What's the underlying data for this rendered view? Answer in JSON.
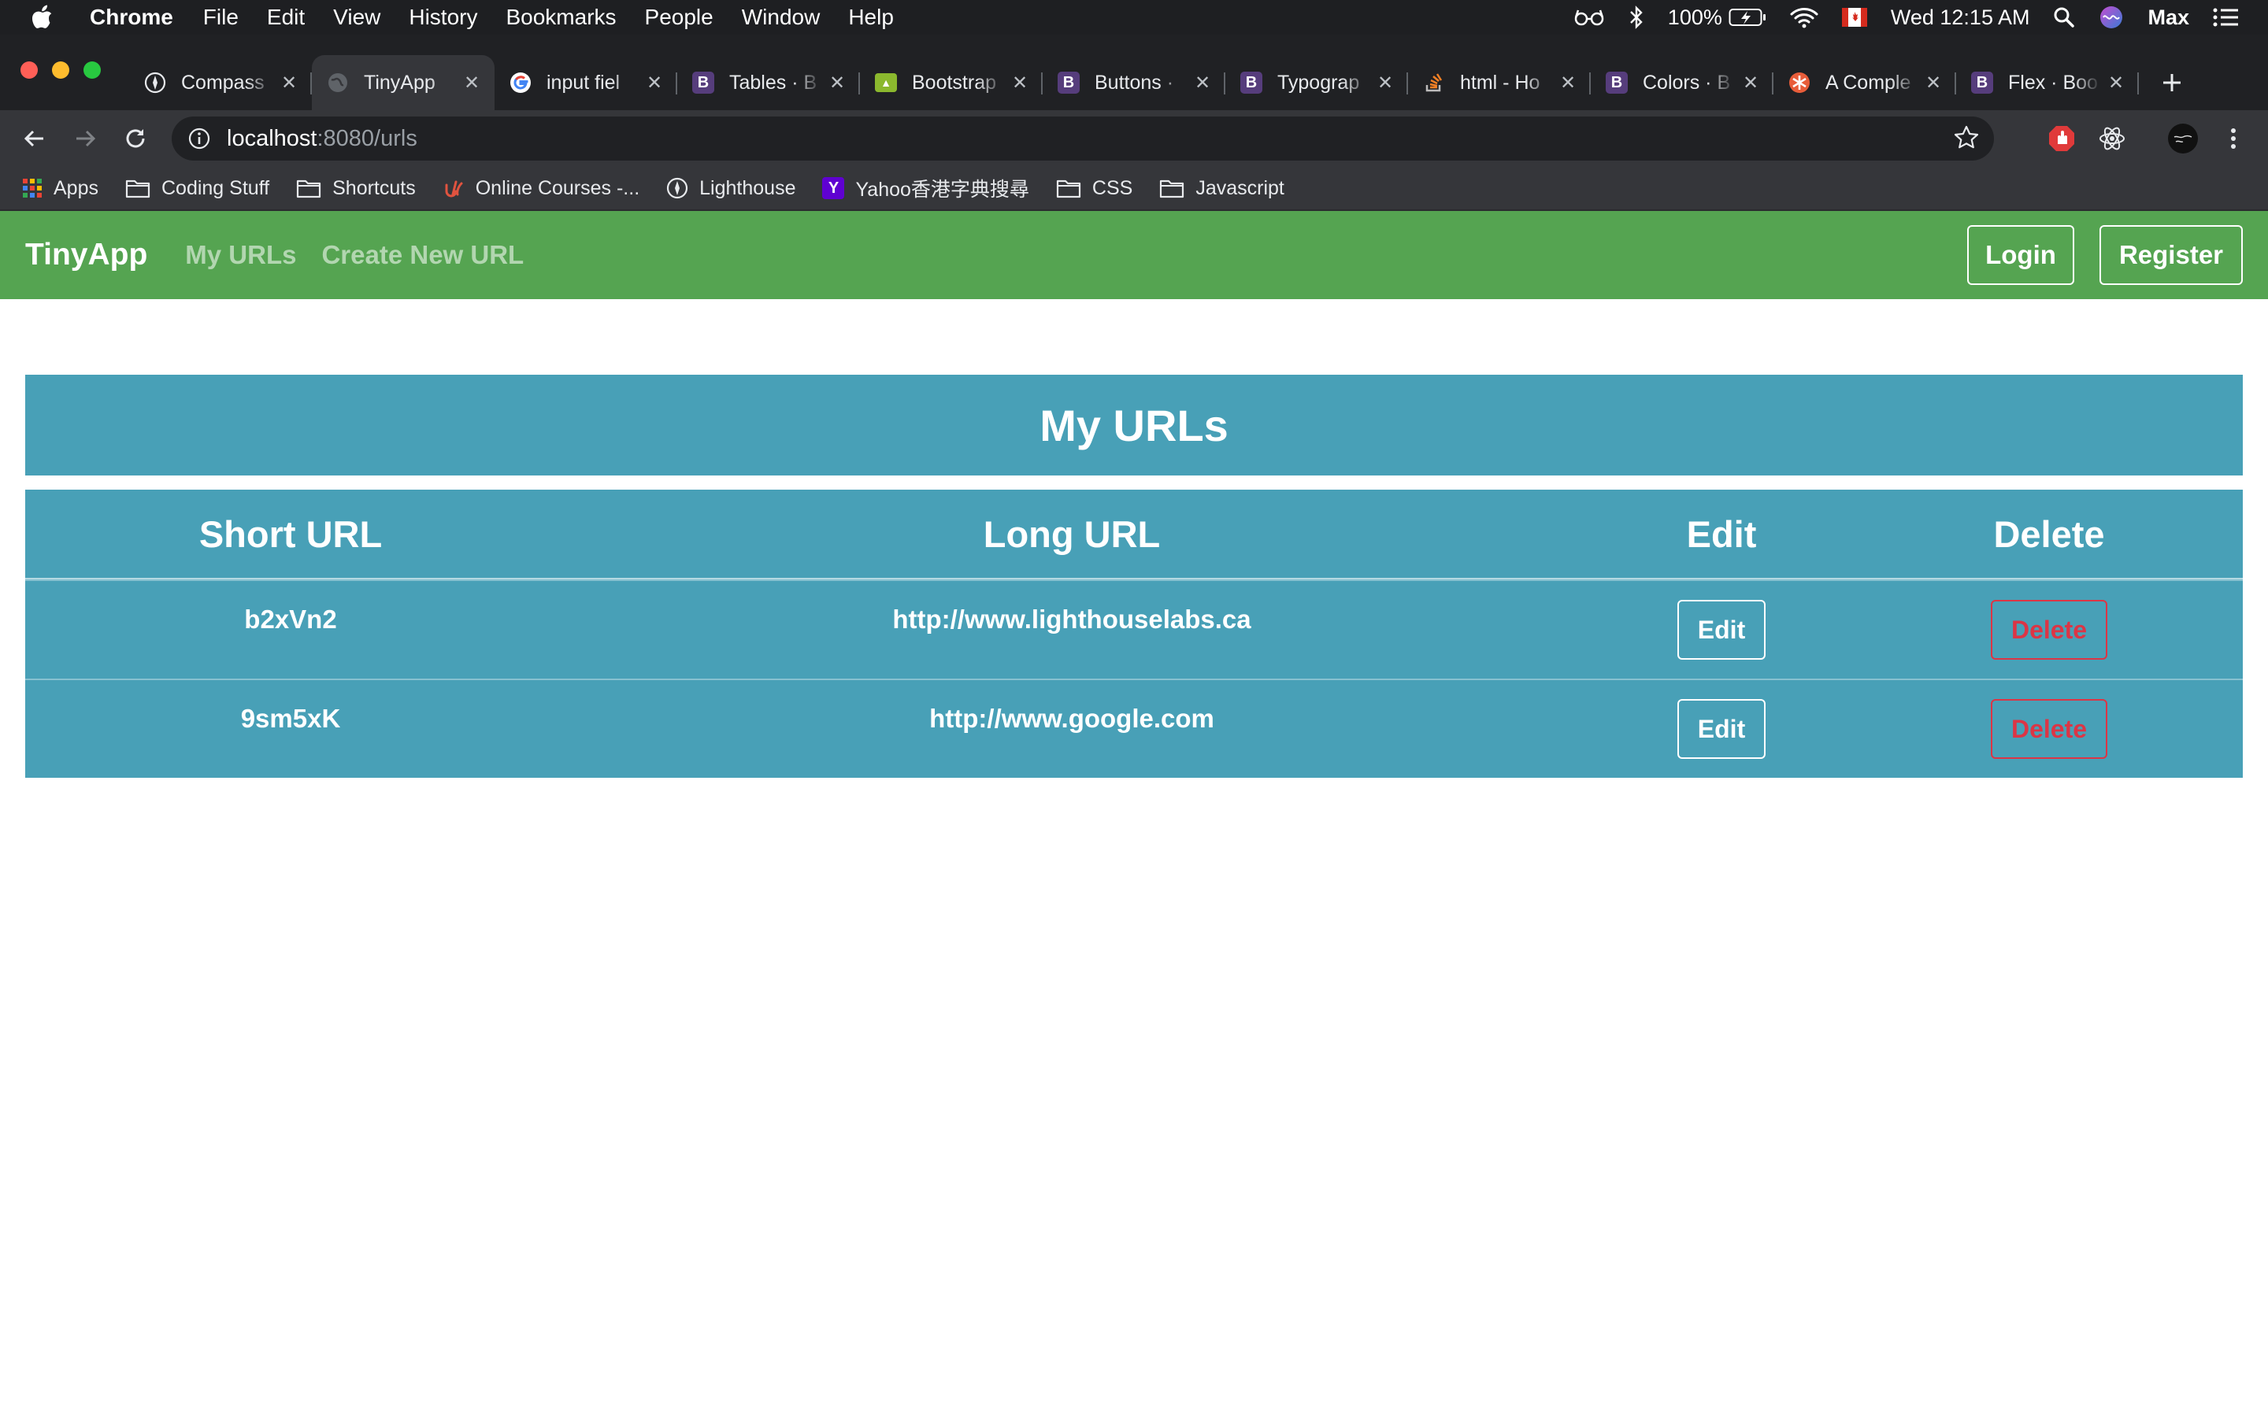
{
  "menubar": {
    "app_name": "Chrome",
    "items": [
      "File",
      "Edit",
      "View",
      "History",
      "Bookmarks",
      "People",
      "Window",
      "Help"
    ],
    "battery": "100%",
    "clock": "Wed 12:15 AM",
    "user": "Max"
  },
  "tabs": [
    {
      "title": "Compass",
      "favicon": "compass-icon",
      "active": false
    },
    {
      "title": "TinyApp",
      "favicon": "globe-icon",
      "active": true
    },
    {
      "title": "input fiel",
      "favicon": "google-icon",
      "active": false
    },
    {
      "title": "Tables · B",
      "favicon": "bootstrap-icon",
      "active": false
    },
    {
      "title": "Bootstrap",
      "favicon": "bootstrap-green-icon",
      "active": false
    },
    {
      "title": "Buttons · ",
      "favicon": "bootstrap-icon",
      "active": false
    },
    {
      "title": "Typograp",
      "favicon": "bootstrap-icon",
      "active": false
    },
    {
      "title": "html - Ho",
      "favicon": "stackoverflow-icon",
      "active": false
    },
    {
      "title": "Colors · B",
      "favicon": "bootstrap-icon",
      "active": false
    },
    {
      "title": "A Comple",
      "favicon": "orange-asterisk-icon",
      "active": false
    },
    {
      "title": "Flex · Boo",
      "favicon": "bootstrap-icon",
      "active": false
    }
  ],
  "address": {
    "host": "localhost",
    "path": ":8080/urls"
  },
  "bookmarks": [
    {
      "label": "Apps",
      "icon": "apps-grid-icon"
    },
    {
      "label": "Coding Stuff",
      "icon": "folder-icon"
    },
    {
      "label": "Shortcuts",
      "icon": "folder-icon"
    },
    {
      "label": "Online Courses -...",
      "icon": "udemy-icon"
    },
    {
      "label": "Lighthouse",
      "icon": "compass-icon"
    },
    {
      "label": "Yahoo香港字典搜尋",
      "icon": "yahoo-icon"
    },
    {
      "label": "CSS",
      "icon": "folder-icon"
    },
    {
      "label": "Javascript",
      "icon": "folder-icon"
    }
  ],
  "site": {
    "brand": "TinyApp",
    "nav": {
      "my_urls": "My URLs",
      "create": "Create New URL"
    },
    "login": "Login",
    "register": "Register",
    "heading": "My URLs",
    "colors": {
      "navbar": "#55a451",
      "table": "#48a0b7",
      "danger": "#dc3545"
    }
  },
  "table": {
    "headers": {
      "short": "Short URL",
      "long": "Long URL",
      "edit": "Edit",
      "delete": "Delete"
    },
    "rows": [
      {
        "short": "b2xVn2",
        "long": "http://www.lighthouselabs.ca",
        "edit": "Edit",
        "delete": "Delete"
      },
      {
        "short": "9sm5xK",
        "long": "http://www.google.com",
        "edit": "Edit",
        "delete": "Delete"
      }
    ]
  }
}
